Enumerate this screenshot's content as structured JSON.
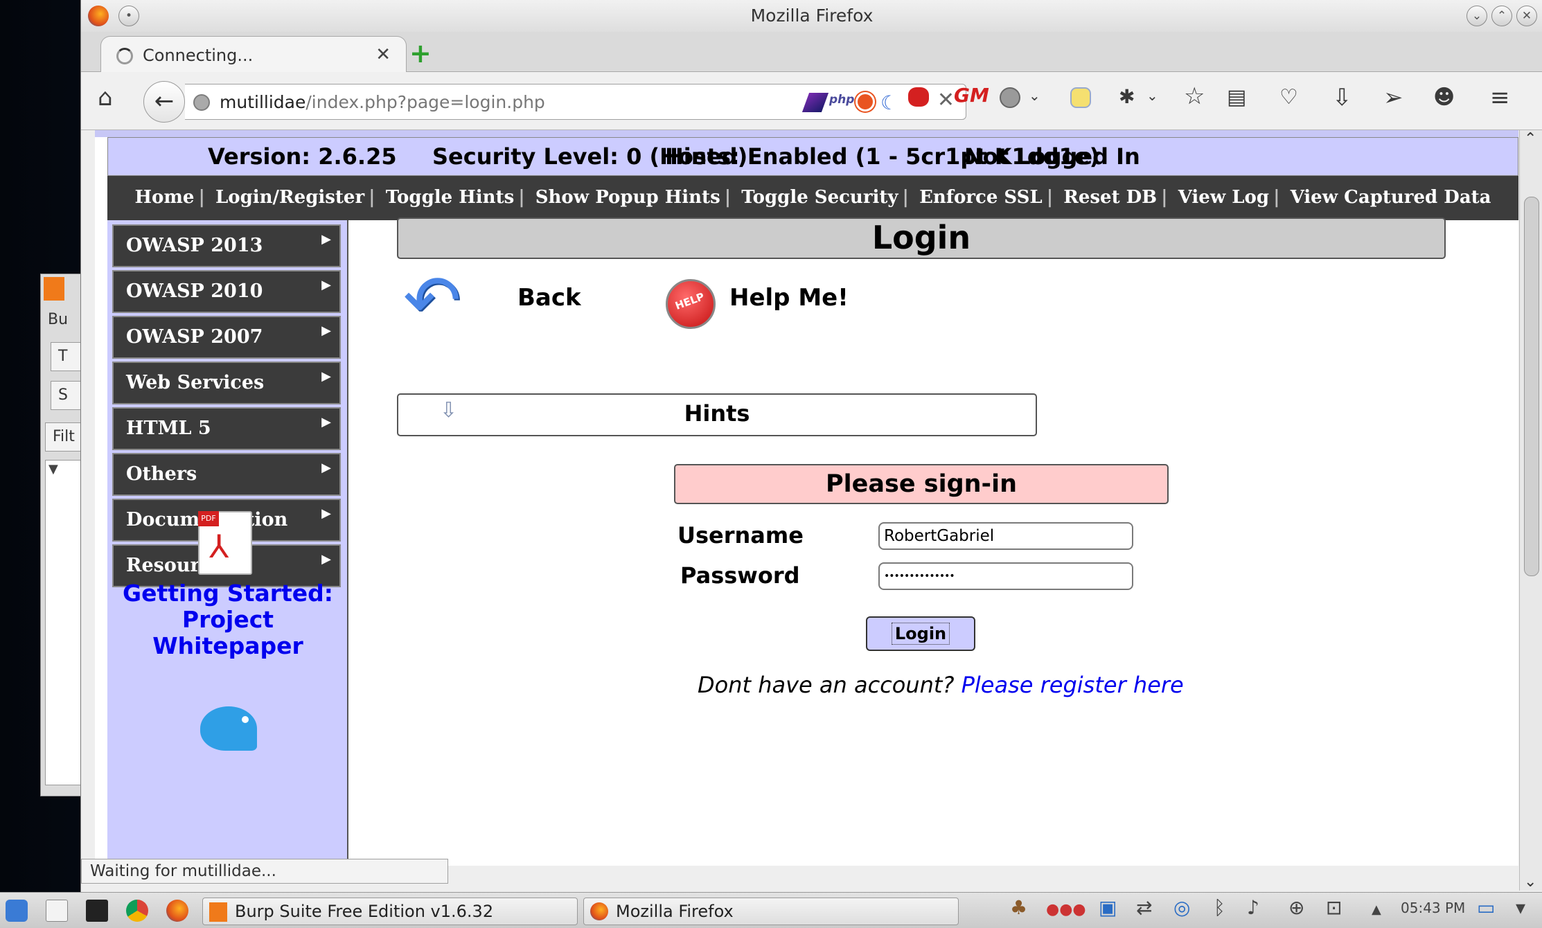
{
  "window": {
    "title": "Mozilla Firefox"
  },
  "tab": {
    "label": "Connecting..."
  },
  "url": {
    "host": "mutillidae",
    "path": "/index.php?page=login.php"
  },
  "header": {
    "version": "Version: 2.6.25",
    "security": "Security Level: 0 (Hosed)",
    "hints": "Hints: Enabled (1 - 5cr1pt K1dd1e)",
    "login_state": "Not Logged In"
  },
  "menu": [
    "Home",
    "Login/Register",
    "Toggle Hints",
    "Show Popup Hints",
    "Toggle Security",
    "Enforce SSL",
    "Reset DB",
    "View Log",
    "View Captured Data"
  ],
  "sidebar": {
    "items": [
      "OWASP 2013",
      "OWASP 2010",
      "OWASP 2007",
      "Web Services",
      "HTML 5",
      "Others",
      "Documentation",
      "Resources"
    ],
    "getting_started": "Getting Started: Project Whitepaper"
  },
  "main": {
    "title": "Login",
    "back": "Back",
    "help": "Help Me!",
    "help_badge": "HELP",
    "hints": "Hints",
    "signin": "Please sign-in",
    "username_label": "Username",
    "username_value": "RobertGabriel",
    "password_label": "Password",
    "password_value": "••••••••••••••",
    "login_button": "Login",
    "no_account": "Dont have an account?",
    "register_link": "Please register here"
  },
  "status_bar": "Waiting for mutillidae...",
  "background_window": {
    "items": [
      "Bu",
      "T",
      "S",
      "Filt"
    ]
  },
  "taskbar": {
    "items": [
      "Burp Suite Free Edition v1.6.32",
      "Mozilla Firefox"
    ],
    "clock": "05:43 PM"
  }
}
